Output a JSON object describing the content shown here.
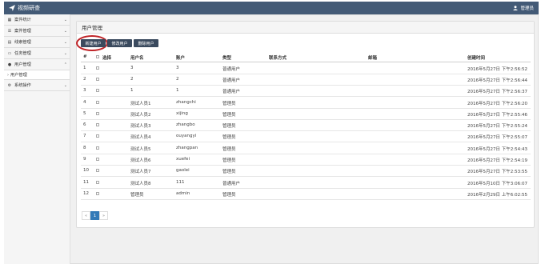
{
  "header": {
    "title": "视频研查",
    "user_name": "管理员"
  },
  "sidebar": {
    "items": [
      {
        "label": "案件统计",
        "icon": "chart-icon"
      },
      {
        "label": "案件管理",
        "icon": "list-icon"
      },
      {
        "label": "线索管理",
        "icon": "table-icon"
      },
      {
        "label": "任务管理",
        "icon": "inbox-icon"
      },
      {
        "label": "用户管理",
        "icon": "user-icon"
      }
    ],
    "sub_item": "用户管理",
    "last_item": {
      "label": "系统操作",
      "icon": "gear-icon"
    }
  },
  "panel": {
    "title": "用户管理"
  },
  "toolbar": {
    "new_label": "新建用户",
    "edit_label": "修改用户",
    "delete_label": "删除用户"
  },
  "table": {
    "headers": {
      "index": "#",
      "select": "选择",
      "username": "用户名",
      "account": "账户",
      "type": "类型",
      "contact": "联系方式",
      "email": "邮箱",
      "created": "创建时间"
    },
    "rows": [
      {
        "index": "1",
        "username": "3",
        "account": "3",
        "type": "普通用户",
        "created": "2016年5月27日 下午2:56:52"
      },
      {
        "index": "2",
        "username": "2",
        "account": "2",
        "type": "普通用户",
        "created": "2016年5月27日 下午2:56:44"
      },
      {
        "index": "3",
        "username": "1",
        "account": "1",
        "type": "普通用户",
        "created": "2016年5月27日 下午2:56:37"
      },
      {
        "index": "4",
        "username": "测试人员1",
        "account": "zhangchi",
        "type": "管理员",
        "created": "2016年5月27日 下午2:56:20"
      },
      {
        "index": "5",
        "username": "测试人员2",
        "account": "xijing",
        "type": "管理员",
        "created": "2016年5月27日 下午2:55:46"
      },
      {
        "index": "6",
        "username": "测试人员3",
        "account": "zhangbo",
        "type": "管理员",
        "created": "2016年5月27日 下午2:55:24"
      },
      {
        "index": "7",
        "username": "测试人员4",
        "account": "ouyangyi",
        "type": "管理员",
        "created": "2016年5月27日 下午2:55:07"
      },
      {
        "index": "8",
        "username": "测试人员5",
        "account": "zhangpan",
        "type": "管理员",
        "created": "2016年5月27日 下午2:54:43"
      },
      {
        "index": "9",
        "username": "测试人员6",
        "account": "xuefei",
        "type": "管理员",
        "created": "2016年5月27日 下午2:54:19"
      },
      {
        "index": "10",
        "username": "测试人员7",
        "account": "gaolei",
        "type": "管理员",
        "created": "2016年5月27日 下午2:53:55"
      },
      {
        "index": "11",
        "username": "测试人员8",
        "account": "111",
        "type": "普通用户",
        "created": "2016年5月10日 下午3:06:07"
      },
      {
        "index": "12",
        "username": "管理员",
        "account": "admin",
        "type": "管理员",
        "created": "2016年2月29日 上午6:02:55"
      }
    ]
  },
  "pagination": {
    "prev": "«",
    "current": "1",
    "next": "»"
  },
  "colors": {
    "topbar": "#435a76",
    "button": "#3a4a5e",
    "highlight_circle": "#c02428",
    "page_active": "#337ab7"
  }
}
